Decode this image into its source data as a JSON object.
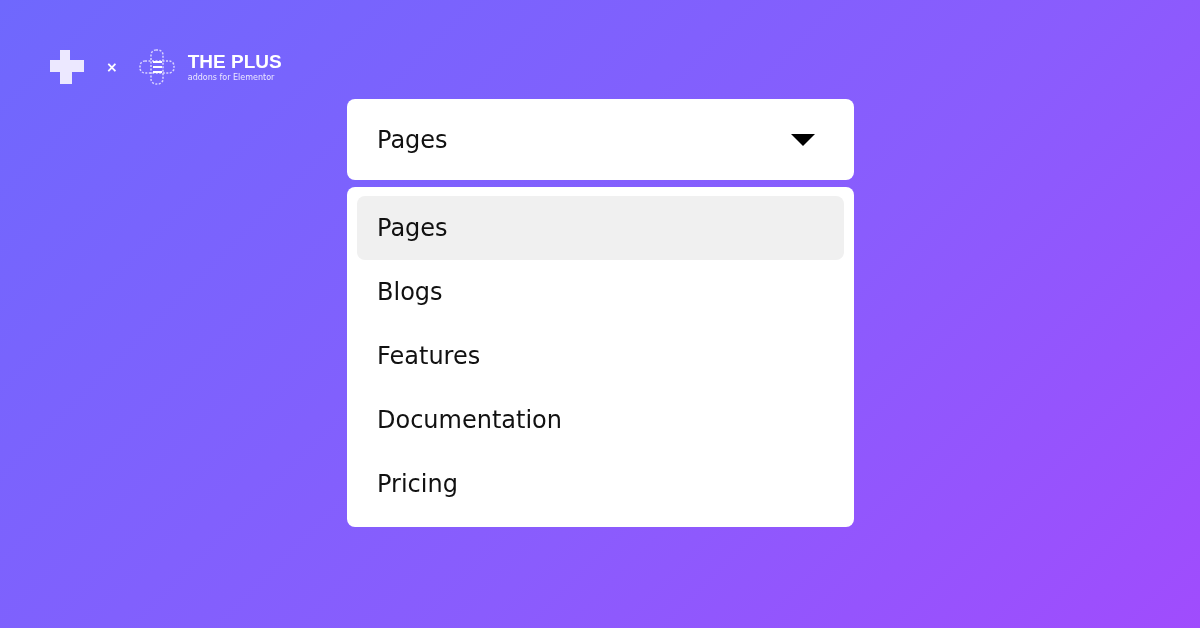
{
  "brand": {
    "separator": "×",
    "name": "THE PLUS",
    "tagline": "addons for Elementor"
  },
  "dropdown": {
    "value": "Pages",
    "expanded": true,
    "options": [
      {
        "label": "Pages",
        "selected": true
      },
      {
        "label": "Blogs",
        "selected": false
      },
      {
        "label": "Features",
        "selected": false
      },
      {
        "label": "Documentation",
        "selected": false
      },
      {
        "label": "Pricing",
        "selected": false
      }
    ]
  }
}
